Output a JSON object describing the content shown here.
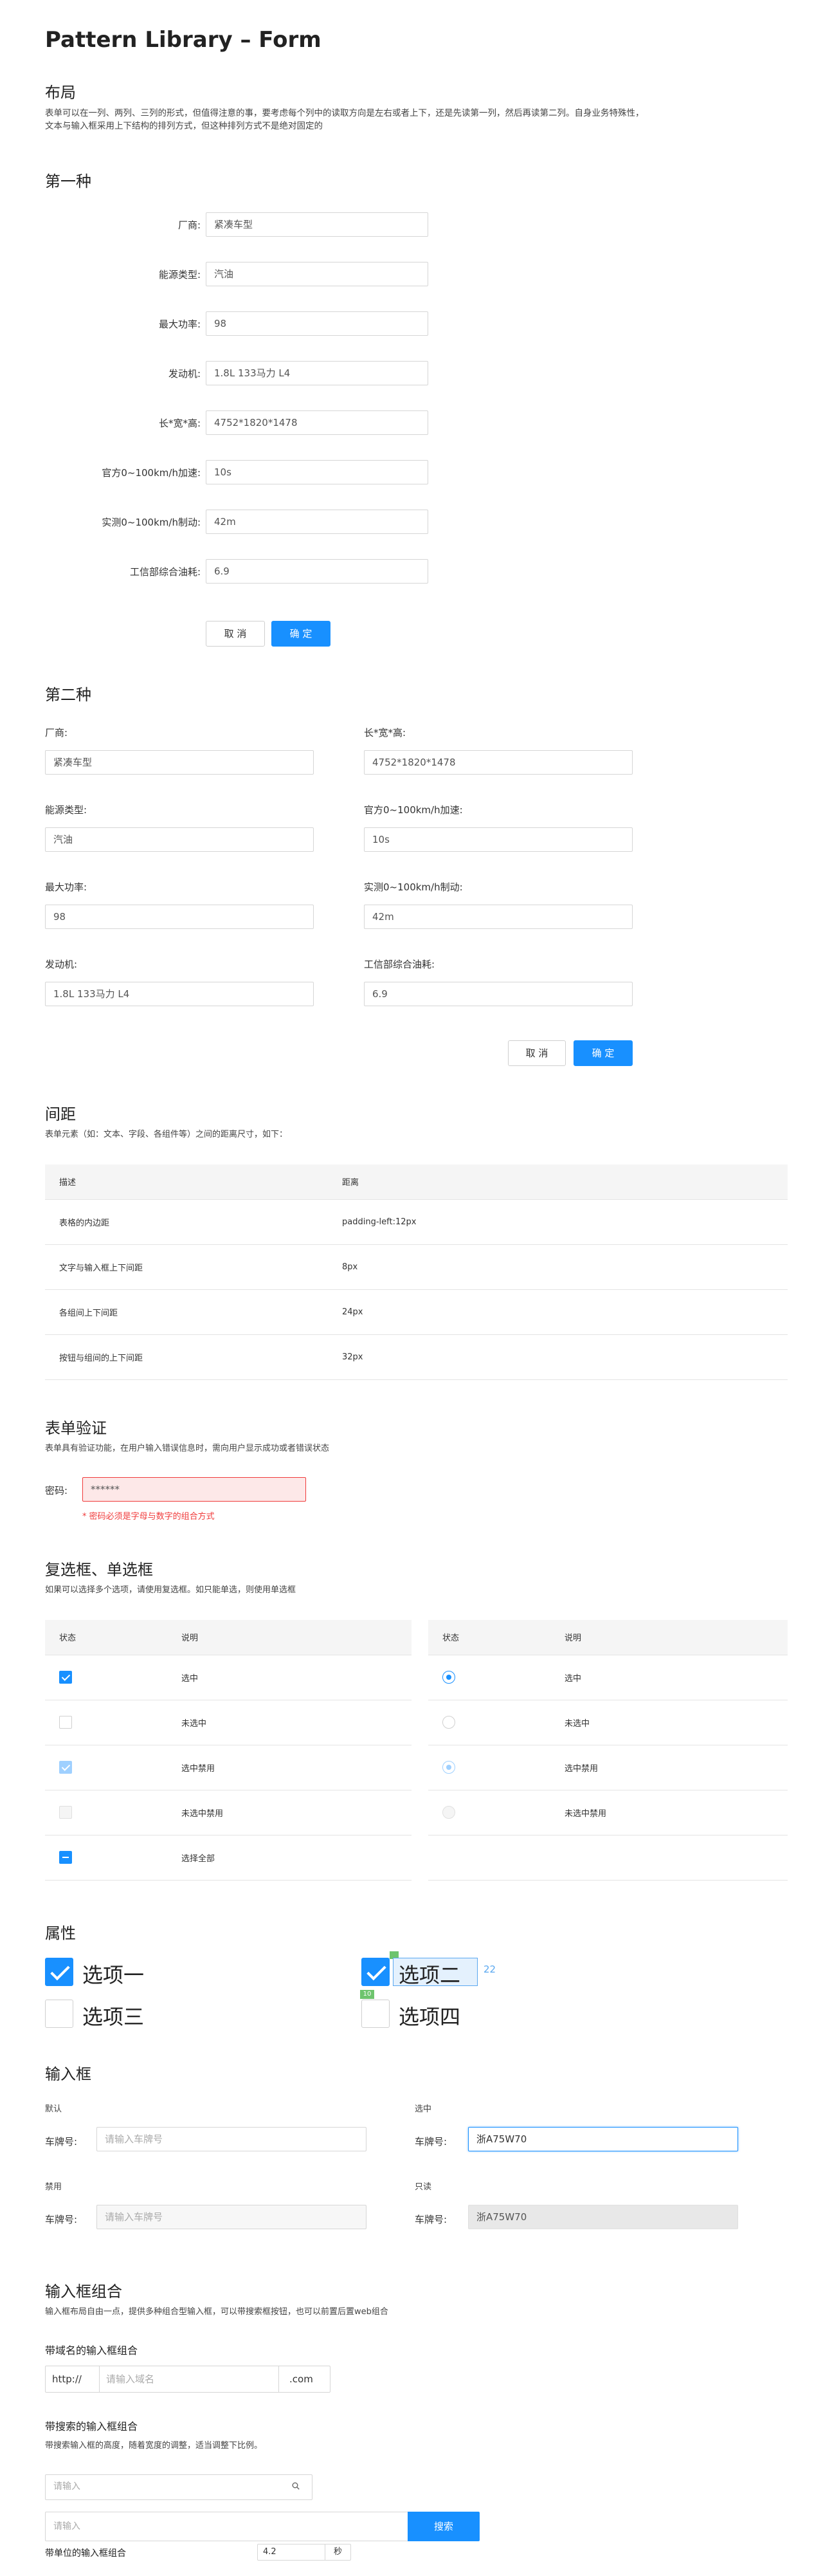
{
  "title": "Pattern Library – Form",
  "layout": {
    "heading": "布局",
    "desc_line1": "表单可以在一列、两列、三列的形式，但值得注意的事，要考虑每个列中的读取方向是左右或者上下，还是先读第一列，然后再读第二列。自身业务特殊性，",
    "desc_line2": "文本与输入框采用上下结构的排列方式，但这种排列方式不是绝对固定的"
  },
  "form1": {
    "heading": "第一种",
    "fields": [
      {
        "label": "厂商:",
        "value": "紧凑车型"
      },
      {
        "label": "能源类型:",
        "value": "汽油"
      },
      {
        "label": "最大功率:",
        "value": "98"
      },
      {
        "label": "发动机:",
        "value": "1.8L 133马力 L4"
      },
      {
        "label": "长*宽*高:",
        "value": "4752*1820*1478"
      },
      {
        "label": "官方0~100km/h加速:",
        "value": "10s"
      },
      {
        "label": "实测0~100km/h制动:",
        "value": "42m"
      },
      {
        "label": "工信部综合油耗:",
        "value": "6.9"
      }
    ],
    "cancel": "取 消",
    "ok": "确 定"
  },
  "form2": {
    "heading": "第二种",
    "left": [
      {
        "label": "厂商:",
        "value": "紧凑车型"
      },
      {
        "label": "能源类型:",
        "value": "汽油"
      },
      {
        "label": "最大功率:",
        "value": "98"
      },
      {
        "label": "发动机:",
        "value": "1.8L 133马力 L4"
      }
    ],
    "right": [
      {
        "label": "长*宽*高:",
        "value": "4752*1820*1478"
      },
      {
        "label": "官方0~100km/h加速:",
        "value": "10s"
      },
      {
        "label": "实测0~100km/h制动:",
        "value": "42m"
      },
      {
        "label": "工信部综合油耗:",
        "value": "6.9"
      }
    ],
    "cancel": "取 消",
    "ok": "确 定"
  },
  "spacing": {
    "heading": "间距",
    "desc": "表单元素（如：文本、字段、各组件等）之间的距离尺寸，如下：",
    "col1": "描述",
    "col2": "距离",
    "rows": [
      {
        "d": "表格的内边距",
        "v": "padding-left:12px"
      },
      {
        "d": "文字与输入框上下间距",
        "v": "8px"
      },
      {
        "d": "各组间上下间距",
        "v": "24px"
      },
      {
        "d": "按钮与组间的上下间距",
        "v": "32px"
      }
    ]
  },
  "validation": {
    "heading": "表单验证",
    "desc": "表单具有验证功能，在用户输入错误信息时，需向用户显示成功或者错误状态",
    "label": "密码:",
    "value": "******",
    "error": "* 密码必须是字母与数字的组合方式"
  },
  "checks": {
    "heading": "复选框、单选框",
    "desc": "如果可以选择多个选项，请使用复选框。如只能单选，则使用单选框",
    "col1": "状态",
    "col2": "说明",
    "cb_rows": [
      "选中",
      "未选中",
      "选中禁用",
      "未选中禁用",
      "选择全部"
    ],
    "rd_rows": [
      "选中",
      "未选中",
      "选中禁用",
      "未选中禁用"
    ]
  },
  "props": {
    "heading": "属性",
    "opt1": "选项一",
    "opt2": "选项二",
    "opt3": "选项三",
    "opt4": "选项四",
    "measure_w": "22",
    "measure_h": "10"
  },
  "inputs": {
    "heading": "输入框",
    "default_title": "默认",
    "selected_title": "选中",
    "disabled_title": "禁用",
    "readonly_title": "只读",
    "label": "车牌号:",
    "placeholder": "请输入车牌号",
    "value": "浙A75W70"
  },
  "combo": {
    "heading": "输入框组合",
    "desc": "输入框布局自由一点，提供多种组合型输入框，可以带搜索框按钮，也可以前置后置web组合",
    "domain_title": "带域名的输入框组合",
    "prefix": "http://",
    "domain_placeholder": "请输入域名",
    "suffix": ".com",
    "search_title": "带搜索的输入框组合",
    "search_desc": "带搜索输入框的高度，随着宽度的调整，适当调整下比例。",
    "search_placeholder": "请输入",
    "search_btn": "搜索",
    "unit_title": "带单位的输入框组合",
    "unit_value": "4.2",
    "unit": "秒"
  }
}
